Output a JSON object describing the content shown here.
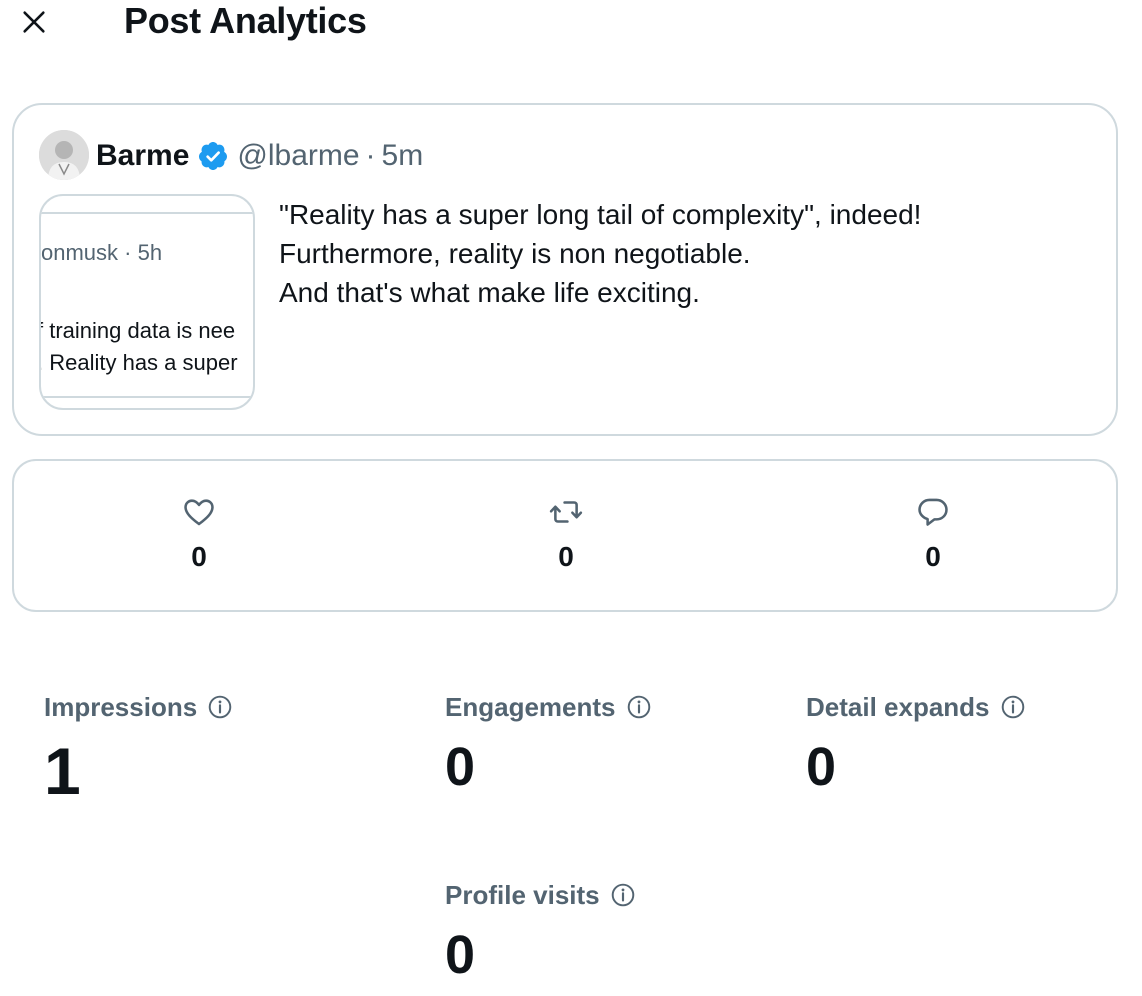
{
  "header": {
    "title": "Post Analytics",
    "close_icon": "close-icon"
  },
  "post": {
    "author_name": "Barme",
    "verified_icon": "verified-badge-icon",
    "verified_color": "#1d9bf0",
    "handle": "@lbarme",
    "separator": "·",
    "time": "5m",
    "text_lines": [
      "\"Reality has a super long tail of complexity\", indeed!",
      "Furthermore, reality is non negotiable.",
      "And that's what make life exciting."
    ],
    "quoted": {
      "meta": "onmusk · 5h",
      "line1": "f training data is nee",
      "line2": ". Reality has a super"
    }
  },
  "engagement": {
    "likes": {
      "icon": "heart-icon",
      "count": "0"
    },
    "reposts": {
      "icon": "repost-icon",
      "count": "0"
    },
    "replies": {
      "icon": "reply-icon",
      "count": "0"
    }
  },
  "metrics": {
    "impressions": {
      "label": "Impressions",
      "value": "1",
      "info_icon": "info-icon"
    },
    "engagements": {
      "label": "Engagements",
      "value": "0",
      "info_icon": "info-icon"
    },
    "detail_expands": {
      "label": "Detail expands",
      "value": "0",
      "info_icon": "info-icon"
    },
    "profile_visits": {
      "label": "Profile visits",
      "value": "0",
      "info_icon": "info-icon"
    }
  },
  "colors": {
    "text_primary": "#0f1419",
    "text_secondary": "#536471",
    "border": "#cfd9de",
    "accent": "#1d9bf0"
  }
}
